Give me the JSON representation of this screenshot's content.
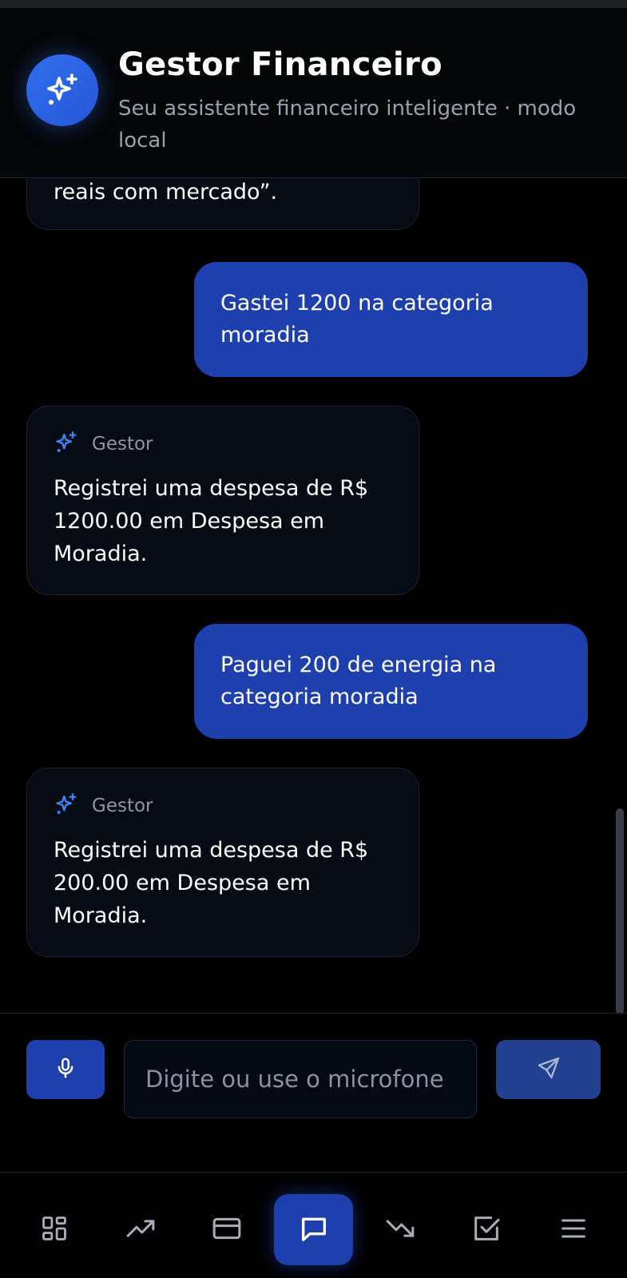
{
  "header": {
    "title": "Gestor Financeiro",
    "subtitle": "Seu assistente financeiro inteligente · modo local",
    "logo_icon": "sparkles-icon"
  },
  "messages": [
    {
      "role": "assistant",
      "text": "reais com mercado”."
    },
    {
      "role": "user",
      "text": "Gastei 1200 na categoria moradia"
    },
    {
      "role": "assistant",
      "author": "Gestor",
      "text": "Registrei uma despesa de R$ 1200.00 em Despesa em Moradia."
    },
    {
      "role": "user",
      "text": "Paguei 200 de energia na categoria moradia"
    },
    {
      "role": "assistant",
      "author": "Gestor",
      "text": "Registrei uma despesa de R$ 200.00 em Despesa em Moradia."
    }
  ],
  "composer": {
    "placeholder": "Digite ou use o microfone",
    "mic_icon": "microphone-icon",
    "send_icon": "send-icon"
  },
  "nav": {
    "items": [
      {
        "id": "dashboard",
        "icon": "grid-icon",
        "active": false
      },
      {
        "id": "receitas",
        "icon": "trending-up-icon",
        "active": false
      },
      {
        "id": "cartoes",
        "icon": "credit-card-icon",
        "active": false
      },
      {
        "id": "chat",
        "icon": "chat-icon",
        "active": true
      },
      {
        "id": "despesas",
        "icon": "trending-down-icon",
        "active": false
      },
      {
        "id": "tarefas",
        "icon": "checkbox-icon",
        "active": false
      },
      {
        "id": "menu",
        "icon": "menu-icon",
        "active": false
      }
    ]
  },
  "colors": {
    "accent": "#1e40af",
    "logo": "#2f6ff0",
    "bubble_bot": "#070b14",
    "background": "#000000"
  }
}
